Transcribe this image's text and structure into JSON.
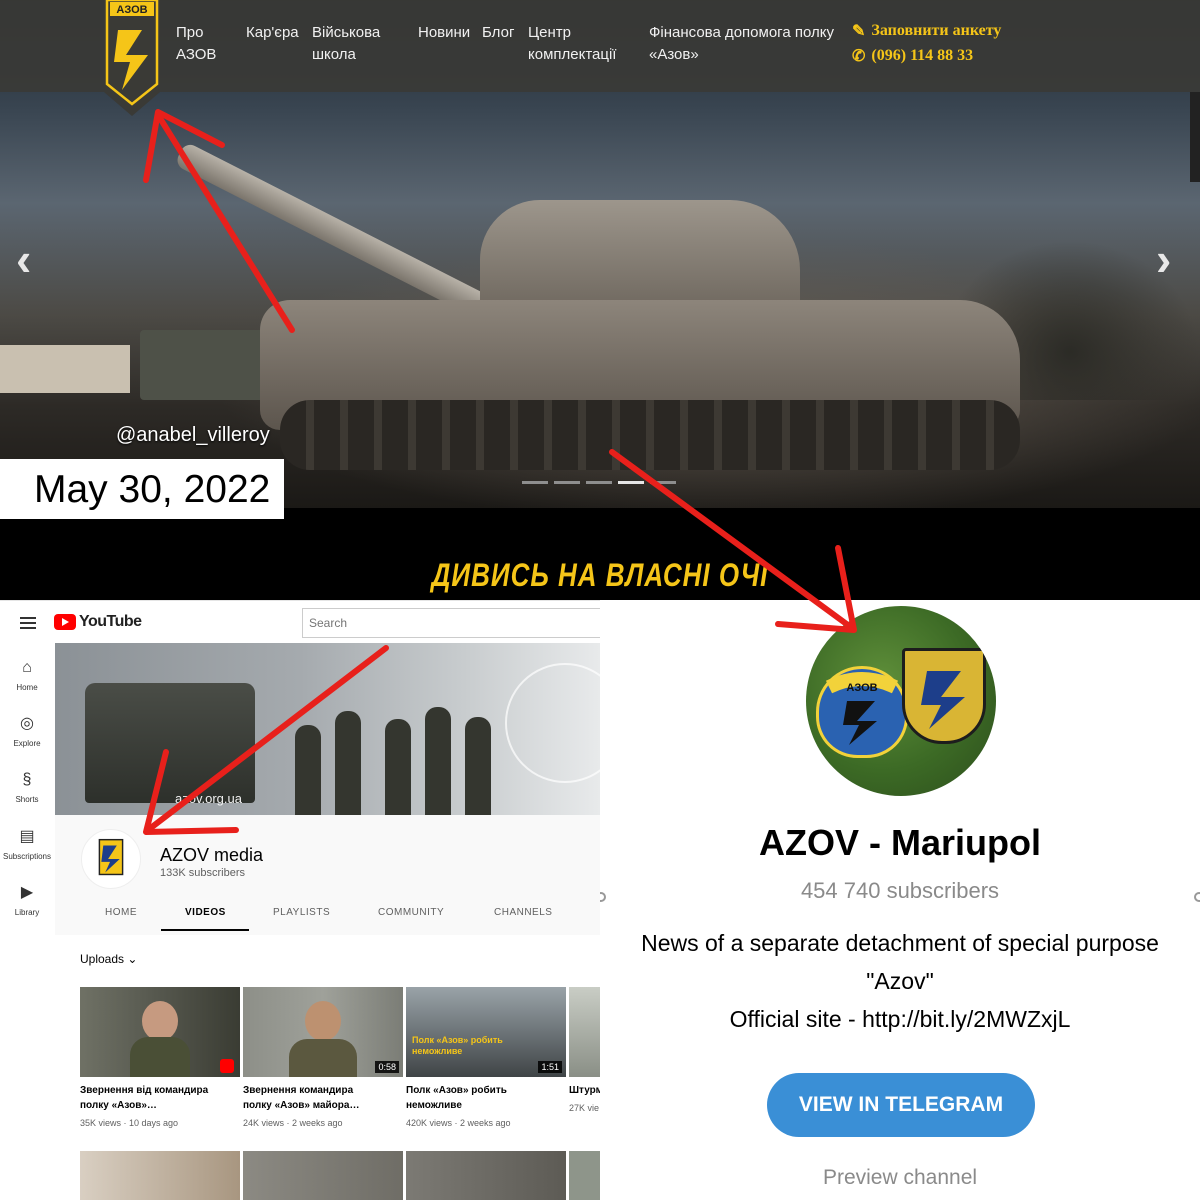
{
  "website": {
    "logo_text": "АЗОВ",
    "nav": [
      {
        "line1": "Про",
        "line2": "АЗОВ"
      },
      {
        "line1": "Кар'єра",
        "line2": ""
      },
      {
        "line1": "Військова",
        "line2": "школа"
      },
      {
        "line1": "Новини",
        "line2": ""
      },
      {
        "line1": "Блог",
        "line2": ""
      },
      {
        "line1": "Центр",
        "line2": "комплектації"
      },
      {
        "line1": "Фінансова допомога полку",
        "line2": "«Азов»"
      }
    ],
    "cta_form": "Заповнити анкету",
    "cta_phone": "(096) 114 88 33",
    "prev_arrow": "‹",
    "next_arrow": "›",
    "photo_credit": "@anabel_villeroy",
    "date": "May 30, 2022",
    "banner": "ДИВИСЬ НА ВЛАСНІ ОЧІ",
    "slides": 5,
    "active_slide": 4
  },
  "youtube": {
    "logo": "YouTube",
    "search_placeholder": "Search",
    "sidebar": [
      {
        "icon": "home-icon",
        "glyph": "⌂",
        "label": "Home"
      },
      {
        "icon": "explore-icon",
        "glyph": "◎",
        "label": "Explore"
      },
      {
        "icon": "shorts-icon",
        "glyph": "§",
        "label": "Shorts"
      },
      {
        "icon": "subscriptions-icon",
        "glyph": "▤",
        "label": "Subscriptions"
      },
      {
        "icon": "library-icon",
        "glyph": "▶",
        "label": "Library"
      }
    ],
    "banner_url": "azov.org.ua",
    "channel_name": "AZOV media",
    "channel_subs": "133K subscribers",
    "tabs": [
      "HOME",
      "VIDEOS",
      "PLAYLISTS",
      "COMMUNITY",
      "CHANNELS"
    ],
    "active_tab": "VIDEOS",
    "uploads_label": "Uploads",
    "videos": [
      {
        "title_line1": "Звернення від командира",
        "title_line2": "полку «Азов»…",
        "meta": "35K views · 10 days ago",
        "duration": ""
      },
      {
        "title_line1": "Звернення командира",
        "title_line2": "полку «Азов» майора…",
        "meta": "24K views · 2 weeks ago",
        "duration": "0:58"
      },
      {
        "title_line1": "Полк «Азов» робить",
        "title_line2": "неможливе",
        "meta": "420K views · 2 weeks ago",
        "duration": "1:51",
        "overlay": "Полк «Азов» робить неможливе"
      },
      {
        "title_line1": "Штурм",
        "title_line2": "",
        "meta": "27K vie",
        "duration": ""
      }
    ]
  },
  "telegram": {
    "channel_title": "AZOV - Mariupol",
    "subscribers": "454 740 subscribers",
    "desc_line1": "News of a separate detachment of special purpose",
    "desc_line2": "\"Azov\"",
    "desc_line3": "Official site - http://bit.ly/2MWZxjL",
    "button": "VIEW IN TELEGRAM",
    "preview": "Preview channel",
    "patch_text": "АЗОВ"
  },
  "colors": {
    "accent_yellow": "#f5c518",
    "arrow_red": "#e8201b",
    "telegram_blue": "#3a8fd6",
    "youtube_red": "#ff0000"
  }
}
